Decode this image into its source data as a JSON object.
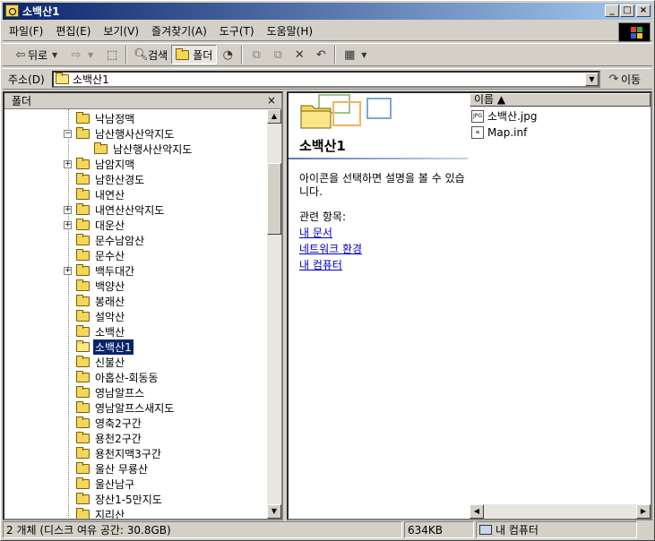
{
  "window": {
    "title": "소백산1"
  },
  "title_buttons": {
    "minimize": "_",
    "maximize": "□",
    "close": "×"
  },
  "menu": [
    {
      "name": "menu-file",
      "label": "파일(F)"
    },
    {
      "name": "menu-edit",
      "label": "편집(E)"
    },
    {
      "name": "menu-view",
      "label": "보기(V)"
    },
    {
      "name": "menu-favorites",
      "label": "즐겨찾기(A)"
    },
    {
      "name": "menu-tools",
      "label": "도구(T)"
    },
    {
      "name": "menu-help",
      "label": "도움말(H)"
    }
  ],
  "toolbar": {
    "back_label": "뒤로",
    "search_label": "검색",
    "folders_label": "폴더"
  },
  "address": {
    "label": "주소(D)",
    "value": "소백산1",
    "go_label": "이동"
  },
  "folder_pane": {
    "header": "폴더",
    "close": "×",
    "items": [
      {
        "label": "낙남정맥",
        "level": 0,
        "expander": ""
      },
      {
        "label": "남산행사산악지도",
        "level": 0,
        "expander": "−"
      },
      {
        "label": "남산행사산악지도",
        "level": 1,
        "expander": ""
      },
      {
        "label": "남암지맥",
        "level": 0,
        "expander": "+"
      },
      {
        "label": "남한산경도",
        "level": 0,
        "expander": ""
      },
      {
        "label": "내연산",
        "level": 0,
        "expander": ""
      },
      {
        "label": "내연산산악지도",
        "level": 0,
        "expander": "+"
      },
      {
        "label": "대운산",
        "level": 0,
        "expander": "+"
      },
      {
        "label": "문수남암산",
        "level": 0,
        "expander": ""
      },
      {
        "label": "문수산",
        "level": 0,
        "expander": ""
      },
      {
        "label": "백두대간",
        "level": 0,
        "expander": "+"
      },
      {
        "label": "백양산",
        "level": 0,
        "expander": ""
      },
      {
        "label": "봉래산",
        "level": 0,
        "expander": ""
      },
      {
        "label": "설악산",
        "level": 0,
        "expander": ""
      },
      {
        "label": "소백산",
        "level": 0,
        "expander": ""
      },
      {
        "label": "소백산1",
        "level": 0,
        "expander": "",
        "selected": true
      },
      {
        "label": "신불산",
        "level": 0,
        "expander": ""
      },
      {
        "label": "아홉산-회동동",
        "level": 0,
        "expander": ""
      },
      {
        "label": "영남알프스",
        "level": 0,
        "expander": ""
      },
      {
        "label": "영남알프스새지도",
        "level": 0,
        "expander": ""
      },
      {
        "label": "영축2구간",
        "level": 0,
        "expander": ""
      },
      {
        "label": "용천2구간",
        "level": 0,
        "expander": ""
      },
      {
        "label": "용천지맥3구간",
        "level": 0,
        "expander": ""
      },
      {
        "label": "울산 무룡산",
        "level": 0,
        "expander": ""
      },
      {
        "label": "울산남구",
        "level": 0,
        "expander": ""
      },
      {
        "label": "장산1-5만지도",
        "level": 0,
        "expander": ""
      },
      {
        "label": "지리산",
        "level": 0,
        "expander": ""
      }
    ]
  },
  "webview": {
    "title": "소백산1",
    "description": "아이콘을 선택하면 설명을 볼 수 있습니다.",
    "related_label": "관련 항목:",
    "links": [
      "내 문서",
      "네트워크 환경",
      "내 컴퓨터"
    ]
  },
  "filelist": {
    "column_name": "이름 ▲",
    "files": [
      {
        "name": "소백산.jpg",
        "icon": "jpg-file-icon",
        "badge": "JPG"
      },
      {
        "name": "Map.inf",
        "icon": "inf-file-icon",
        "badge": "≡"
      }
    ]
  },
  "statusbar": {
    "objects": "2 개체 (디스크 여유 공간: 30.8GB)",
    "size": "634KB",
    "location": "내 컴퓨터"
  },
  "colors": {
    "titlebar_start": "#0a246a",
    "titlebar_end": "#a6caf0",
    "selection": "#0a246a",
    "link": "#0000cc"
  }
}
